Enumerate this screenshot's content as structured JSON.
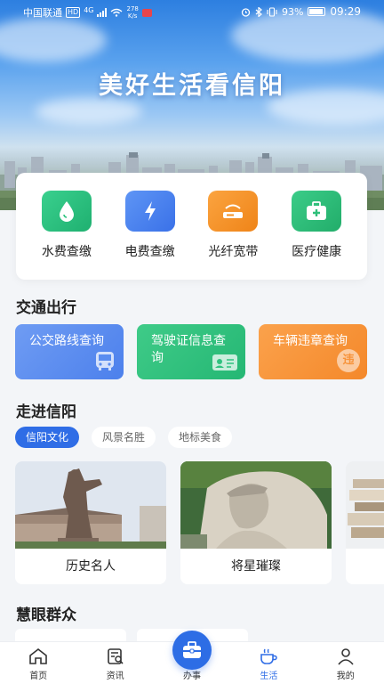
{
  "status_bar": {
    "carrier": "中国联通",
    "network_badge": "HD",
    "network_type": "4G",
    "speed_value": "278",
    "speed_unit": "K/s",
    "battery": "93%",
    "time": "09:29"
  },
  "hero": {
    "title": "美好生活看信阳"
  },
  "services": [
    {
      "label": "水费查缴",
      "icon": "water-drop-icon",
      "color": "#27c27b"
    },
    {
      "label": "电费查缴",
      "icon": "lightning-icon",
      "color": "#3f7ef0"
    },
    {
      "label": "光纤宽带",
      "icon": "router-icon",
      "color": "#f59222"
    },
    {
      "label": "医疗健康",
      "icon": "medical-kit-icon",
      "color": "#2fbf7a"
    }
  ],
  "traffic": {
    "title": "交通出行",
    "cards": [
      {
        "label": "公交路线查询",
        "icon": "bus-icon",
        "color": "#5a8df0"
      },
      {
        "label": "驾驶证信息查询",
        "icon": "id-card-icon",
        "color": "#2fc27f"
      },
      {
        "label": "车辆违章查询",
        "icon": "violation-badge-icon",
        "badge": "违",
        "color": "#f7933a"
      }
    ]
  },
  "explore": {
    "title": "走进信阳",
    "tabs": [
      {
        "label": "信阳文化",
        "active": true
      },
      {
        "label": "风景名胜",
        "active": false
      },
      {
        "label": "地标美食",
        "active": false
      }
    ],
    "cards": [
      {
        "caption": "历史名人"
      },
      {
        "caption": "将星璀璨"
      }
    ]
  },
  "community": {
    "title": "慧眼群众"
  },
  "bottom_nav": [
    {
      "label": "首页",
      "icon": "home-icon",
      "active": false
    },
    {
      "label": "资讯",
      "icon": "news-icon",
      "active": false
    },
    {
      "label": "办事",
      "icon": "briefcase-icon",
      "active": false
    },
    {
      "label": "生活",
      "icon": "coffee-cup-icon",
      "active": true
    },
    {
      "label": "我的",
      "icon": "person-icon",
      "active": false
    }
  ],
  "colors": {
    "accent": "#2f6de6",
    "page_bg": "#f3f5f8"
  }
}
